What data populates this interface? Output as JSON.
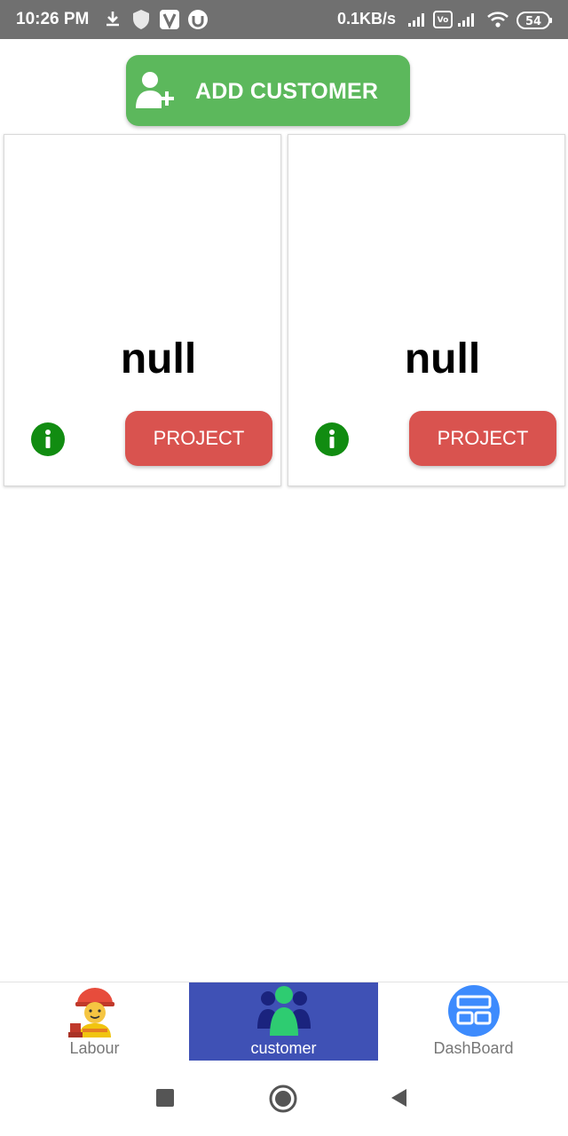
{
  "status_bar": {
    "time": "10:26 PM",
    "network_speed": "0.1KB/s",
    "battery": "54",
    "icons": [
      "download-icon",
      "shield-icon",
      "v-app-icon",
      "torrent-icon",
      "signal-icon",
      "volte-icon",
      "wifi-icon",
      "battery-icon"
    ]
  },
  "add_customer": {
    "label": "ADD CUSTOMER",
    "icon": "add-person-icon",
    "color": "#5cb85c"
  },
  "cards": [
    {
      "name": "null",
      "project_label": "PROJECT",
      "info_icon": "info-icon"
    },
    {
      "name": "null",
      "project_label": "PROJECT",
      "info_icon": "info-icon"
    }
  ],
  "colors": {
    "project_button": "#d9534f",
    "info": "#118c11",
    "nav_active": "#3f51b5"
  },
  "bottom_nav": {
    "items": [
      {
        "label": "Labour",
        "icon": "construction-worker-icon",
        "active": false
      },
      {
        "label": "customer",
        "icon": "customers-group-icon",
        "active": true
      },
      {
        "label": "DashBoard",
        "icon": "dashboard-icon",
        "active": false
      }
    ]
  },
  "system_nav": [
    "recents-icon",
    "home-icon",
    "back-icon"
  ]
}
